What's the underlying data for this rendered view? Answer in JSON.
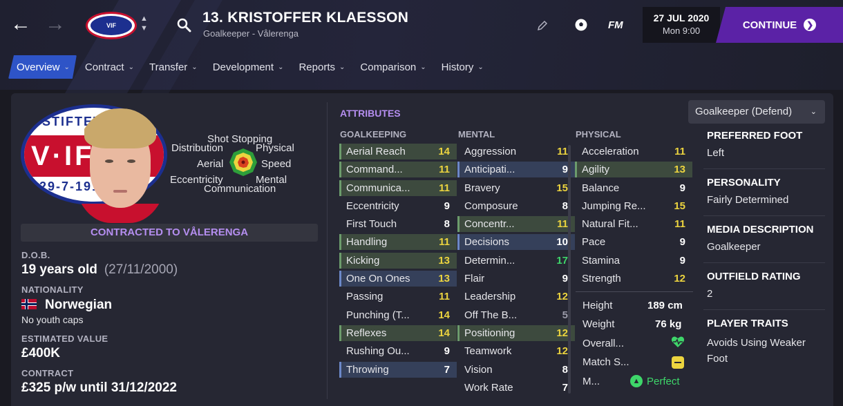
{
  "header": {
    "player_name": "13. KRISTOFFER KLAESSON",
    "player_subtitle": "Goalkeeper - Vålerenga",
    "club_logo_text": "VIF",
    "fm_logo": "FM",
    "date": "27 JUL 2020",
    "time": "Mon 9:00",
    "continue_label": "CONTINUE"
  },
  "tabs": [
    {
      "label": "Overview"
    },
    {
      "label": "Contract"
    },
    {
      "label": "Transfer"
    },
    {
      "label": "Development"
    },
    {
      "label": "Reports"
    },
    {
      "label": "Comparison"
    },
    {
      "label": "History"
    }
  ],
  "radar": {
    "labels": [
      "Shot Stopping",
      "Distribution",
      "Physical",
      "Aerial",
      "Speed",
      "Eccentricity",
      "Mental",
      "Communication"
    ]
  },
  "profile": {
    "contract_banner": "CONTRACTED TO VÅLERENGA",
    "dob_label": "D.O.B.",
    "age": "19 years old",
    "dob": "(27/11/2000)",
    "nationality_label": "NATIONALITY",
    "nationality": "Norwegian",
    "youth_caps": "No youth caps",
    "value_label": "ESTIMATED VALUE",
    "value": "£400K",
    "contract_label": "CONTRACT",
    "contract": "£325 p/w until 31/12/2022"
  },
  "attributes": {
    "title": "ATTRIBUTES",
    "role": "Goalkeeper (Defend)",
    "goalkeeping": {
      "heading": "GOALKEEPING",
      "items": [
        {
          "name": "Aerial Reach",
          "value": "14",
          "hl": "green",
          "tone": "yellow"
        },
        {
          "name": "Command...",
          "value": "11",
          "hl": "green",
          "tone": "yellow"
        },
        {
          "name": "Communica...",
          "value": "11",
          "hl": "green",
          "tone": "yellow"
        },
        {
          "name": "Eccentricity",
          "value": "9",
          "hl": "",
          "tone": "white"
        },
        {
          "name": "First Touch",
          "value": "8",
          "hl": "",
          "tone": "white"
        },
        {
          "name": "Handling",
          "value": "11",
          "hl": "green",
          "tone": "yellow"
        },
        {
          "name": "Kicking",
          "value": "13",
          "hl": "green",
          "tone": "yellow"
        },
        {
          "name": "One On Ones",
          "value": "13",
          "hl": "blue",
          "tone": "yellow"
        },
        {
          "name": "Passing",
          "value": "11",
          "hl": "",
          "tone": "yellow"
        },
        {
          "name": "Punching (T...",
          "value": "14",
          "hl": "",
          "tone": "yellow"
        },
        {
          "name": "Reflexes",
          "value": "14",
          "hl": "green",
          "tone": "yellow"
        },
        {
          "name": "Rushing Ou...",
          "value": "9",
          "hl": "",
          "tone": "white"
        },
        {
          "name": "Throwing",
          "value": "7",
          "hl": "blue",
          "tone": "white"
        }
      ]
    },
    "mental": {
      "heading": "MENTAL",
      "items": [
        {
          "name": "Aggression",
          "value": "11",
          "hl": "",
          "tone": "yellow"
        },
        {
          "name": "Anticipati...",
          "value": "9",
          "hl": "blue",
          "tone": "white"
        },
        {
          "name": "Bravery",
          "value": "15",
          "hl": "",
          "tone": "yellow"
        },
        {
          "name": "Composure",
          "value": "8",
          "hl": "",
          "tone": "white"
        },
        {
          "name": "Concentr...",
          "value": "11",
          "hl": "green",
          "tone": "yellow"
        },
        {
          "name": "Decisions",
          "value": "10",
          "hl": "blue",
          "tone": "white"
        },
        {
          "name": "Determin...",
          "value": "17",
          "hl": "",
          "tone": "green"
        },
        {
          "name": "Flair",
          "value": "9",
          "hl": "",
          "tone": "white"
        },
        {
          "name": "Leadership",
          "value": "12",
          "hl": "",
          "tone": "yellow"
        },
        {
          "name": "Off The B...",
          "value": "5",
          "hl": "",
          "tone": "grey"
        },
        {
          "name": "Positioning",
          "value": "12",
          "hl": "green",
          "tone": "yellow"
        },
        {
          "name": "Teamwork",
          "value": "12",
          "hl": "",
          "tone": "yellow"
        },
        {
          "name": "Vision",
          "value": "8",
          "hl": "",
          "tone": "white"
        },
        {
          "name": "Work Rate",
          "value": "7",
          "hl": "",
          "tone": "white"
        }
      ]
    },
    "physical": {
      "heading": "PHYSICAL",
      "items": [
        {
          "name": "Acceleration",
          "value": "11",
          "hl": "",
          "tone": "yellow"
        },
        {
          "name": "Agility",
          "value": "13",
          "hl": "green",
          "tone": "yellow"
        },
        {
          "name": "Balance",
          "value": "9",
          "hl": "",
          "tone": "white"
        },
        {
          "name": "Jumping Re...",
          "value": "15",
          "hl": "",
          "tone": "yellow"
        },
        {
          "name": "Natural Fit...",
          "value": "11",
          "hl": "",
          "tone": "yellow"
        },
        {
          "name": "Pace",
          "value": "9",
          "hl": "",
          "tone": "white"
        },
        {
          "name": "Stamina",
          "value": "9",
          "hl": "",
          "tone": "white"
        },
        {
          "name": "Strength",
          "value": "12",
          "hl": "",
          "tone": "yellow"
        }
      ]
    },
    "stats": {
      "height_label": "Height",
      "height": "189 cm",
      "weight_label": "Weight",
      "weight": "76 kg",
      "overall_label": "Overall...",
      "match_label": "Match S...",
      "morale_label": "M...",
      "morale": "Perfect"
    }
  },
  "sidebar_info": {
    "foot_label": "PREFERRED FOOT",
    "foot": "Left",
    "personality_label": "PERSONALITY",
    "personality": "Fairly Determined",
    "media_label": "MEDIA DESCRIPTION",
    "media": "Goalkeeper",
    "outfield_label": "OUTFIELD RATING",
    "outfield": "2",
    "traits_label": "PLAYER TRAITS",
    "traits": "Avoids Using Weaker Foot"
  },
  "colors": {
    "accent_purple": "#5b22a6",
    "tab_active": "#2e54c7",
    "value_yellow": "#ecd43f",
    "value_green": "#3ed66a"
  }
}
